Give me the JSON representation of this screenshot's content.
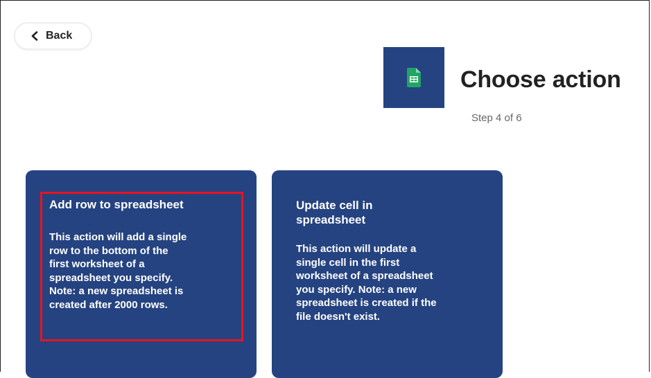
{
  "header": {
    "back_label": "Back",
    "title": "Choose action",
    "step": "Step 4 of 6"
  },
  "service": {
    "icon": "google-sheets-icon",
    "logo_bg": "#254381",
    "icon_color": "#21a464"
  },
  "actions": [
    {
      "title": "Add row to spreadsheet",
      "description": "This action will add a single\nrow to the bottom of the\nfirst worksheet of a\nspreadsheet you specify.\nNote: a new spreadsheet is\ncreated after 2000 rows.",
      "highlighted": true
    },
    {
      "title": "Update cell in\nspreadsheet",
      "description": "This action will update a\nsingle cell in the first\nworksheet of a spreadsheet\nyou specify. Note: a new\nspreadsheet is created if the\nfile doesn't exist.",
      "highlighted": false
    }
  ],
  "colors": {
    "card_bg": "#254381",
    "highlight": "#e8141e",
    "title_text": "#222222",
    "step_text": "#666666"
  }
}
